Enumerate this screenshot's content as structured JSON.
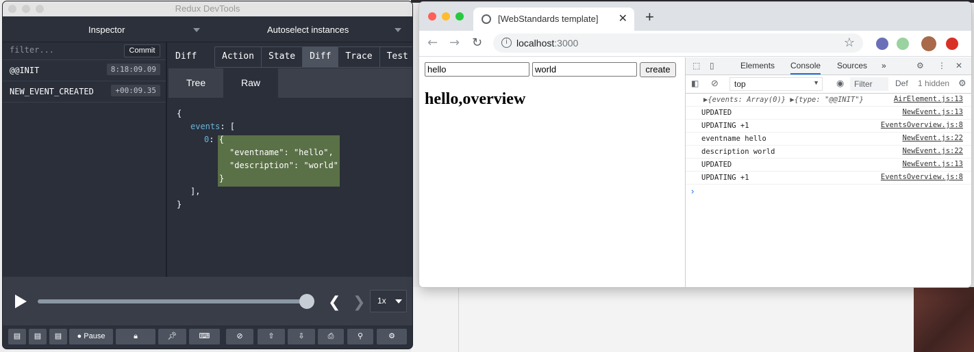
{
  "redux": {
    "window_title": "Redux DevTools",
    "monitor": "Inspector",
    "instances": "Autoselect instances",
    "filter_placeholder": "filter...",
    "commit_label": "Commit",
    "actions": [
      {
        "name": "@@INIT",
        "time": "8:18:09.09"
      },
      {
        "name": "NEW_EVENT_CREATED",
        "time": "+00:09.35"
      }
    ],
    "diff_label": "Diff",
    "tabs": [
      "Action",
      "State",
      "Diff",
      "Trace",
      "Test"
    ],
    "active_tab": "Diff",
    "subtabs": [
      "Tree",
      "Raw"
    ],
    "active_subtab": "Raw",
    "code": {
      "open_brace": "{",
      "events_key": "events",
      "colon_bracket": ": [",
      "index": "0",
      "obj_open": "{",
      "line1": "\"eventname\": \"hello\",",
      "line2": "\"description\": \"world\"",
      "obj_close": "}",
      "array_close": "],",
      "close_brace": "}"
    },
    "slider_progress": 1.0,
    "speed": "1x",
    "pause_label": "Pause"
  },
  "chrome": {
    "tab_title": "[WebStandards template]",
    "url_host": "localhost",
    "url_port": ":3000",
    "page": {
      "input1": "hello",
      "input2": "world",
      "create_label": "create",
      "heading": "hello,overview"
    },
    "devtools": {
      "tabs": [
        "Elements",
        "Console",
        "Sources"
      ],
      "active_tab": "Console",
      "more": "»",
      "context": "top",
      "filter_label": "Filter",
      "levels": "Def",
      "hidden": "1 hidden",
      "prompt": "›",
      "logs": [
        {
          "msg": "▶{events: Array(0)} ▶{type: \"@@INIT\"}",
          "src": "AirElement.js:13"
        },
        {
          "msg": "UPDATED",
          "src": "NewEvent.js:13"
        },
        {
          "msg": "UPDATING +1",
          "src": "EventsOverview.js:8"
        },
        {
          "msg": "eventname hello",
          "src": "NewEvent.js:22"
        },
        {
          "msg": "description world",
          "src": "NewEvent.js:22"
        },
        {
          "msg": "UPDATED",
          "src": "NewEvent.js:13"
        },
        {
          "msg": "UPDATING +1",
          "src": "EventsOverview.js:8"
        }
      ]
    }
  }
}
